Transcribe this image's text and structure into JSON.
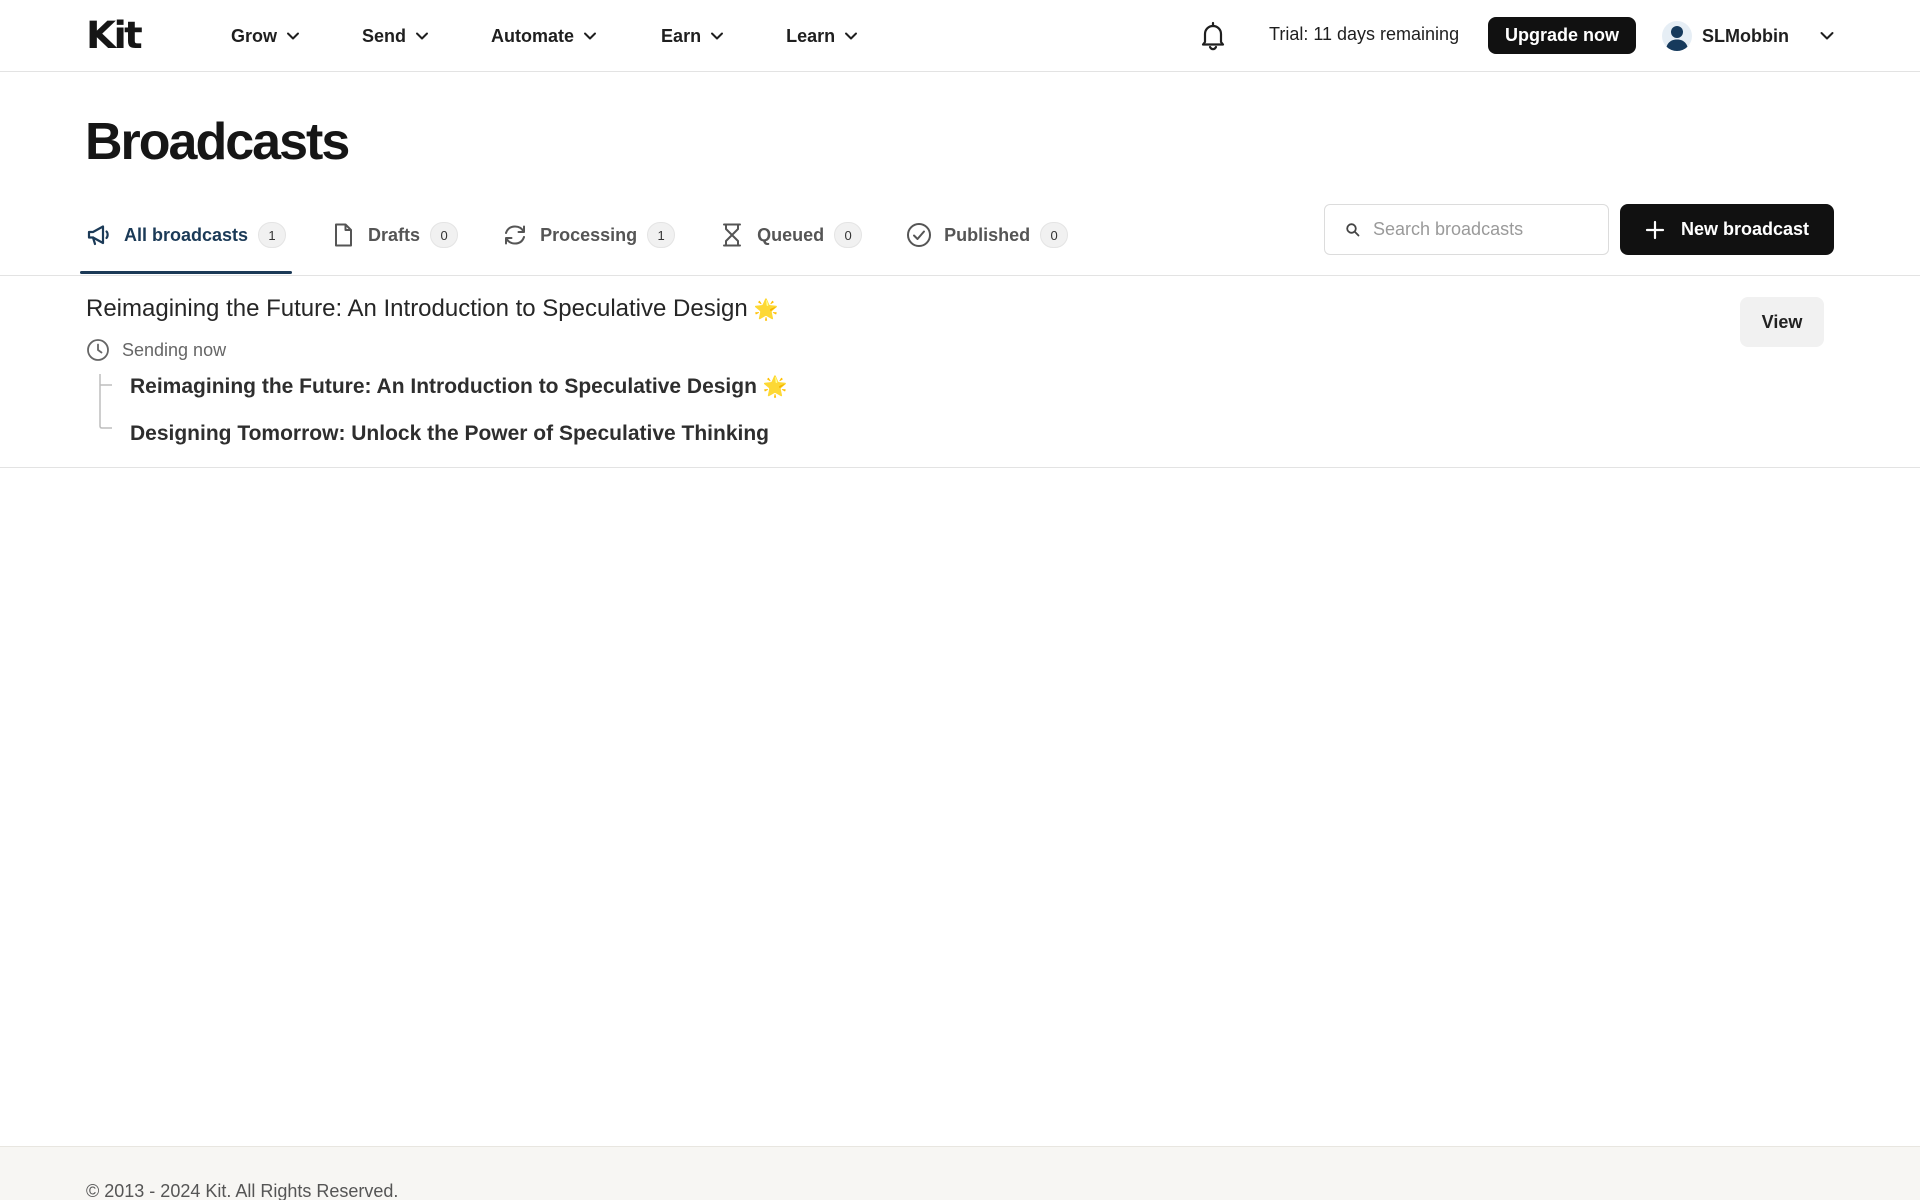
{
  "brand": {
    "logo_text": "Kit"
  },
  "nav": {
    "items": [
      {
        "label": "Grow"
      },
      {
        "label": "Send"
      },
      {
        "label": "Automate"
      },
      {
        "label": "Earn"
      },
      {
        "label": "Learn"
      }
    ],
    "trial_text": "Trial: 11 days remaining",
    "upgrade_label": "Upgrade now",
    "username": "SLMobbin"
  },
  "page": {
    "title": "Broadcasts"
  },
  "tabs": [
    {
      "label": "All broadcasts",
      "count": "1",
      "icon": "megaphone-icon",
      "active": true
    },
    {
      "label": "Drafts",
      "count": "0",
      "icon": "document-icon"
    },
    {
      "label": "Processing",
      "count": "1",
      "icon": "refresh-icon"
    },
    {
      "label": "Queued",
      "count": "0",
      "icon": "hourglass-icon"
    },
    {
      "label": "Published",
      "count": "0",
      "icon": "check-circle-icon"
    }
  ],
  "search": {
    "placeholder": "Search broadcasts"
  },
  "new_broadcast_label": "New broadcast",
  "broadcast": {
    "title": "Reimagining the Future: An Introduction to Speculative Design",
    "title_emoji": "🌟",
    "status": "Sending now",
    "subjects": [
      {
        "text": "Reimagining the Future: An Introduction to Speculative Design",
        "emoji": "🌟"
      },
      {
        "text": "Designing Tomorrow: Unlock the Power of Speculative Thinking"
      }
    ],
    "view_label": "View"
  },
  "footer": {
    "copyright": "© 2013 - 2024 Kit. All Rights Reserved."
  },
  "colors": {
    "accent": "#1b3a57",
    "primary_button": "#111111",
    "footer_bg": "#f7f6f3"
  }
}
